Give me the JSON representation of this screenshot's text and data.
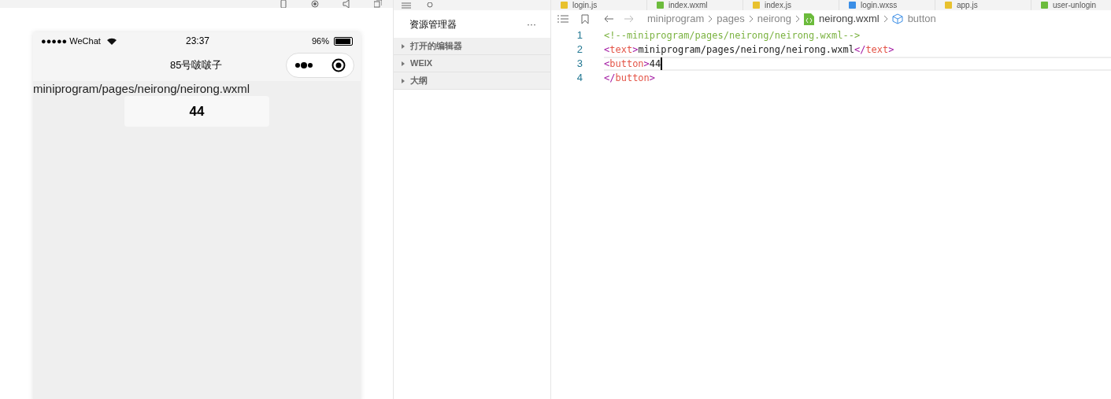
{
  "editor_tabs": [
    {
      "label": "login.js",
      "kind": "js",
      "selected": false
    },
    {
      "label": "index.wxml",
      "kind": "wxml",
      "selected": false
    },
    {
      "label": "index.js",
      "kind": "js",
      "selected": false
    },
    {
      "label": "login.wxss",
      "kind": "wxss",
      "selected": false
    },
    {
      "label": "app.js",
      "kind": "js",
      "selected": false
    },
    {
      "label": "user-unlogin",
      "kind": "wxml",
      "selected": false
    }
  ],
  "phone": {
    "status_bar": {
      "carrier": "●●●●● WeChat",
      "time": "23:37",
      "battery_reading": "96%",
      "battery": {
        "level": 0.96
      }
    },
    "nav_title": "85号啵啵子",
    "page_text": "miniprogram/pages/neirong/neirong.wxml",
    "page_button": "44"
  },
  "explorer": {
    "title": "资源管理器",
    "more": "···",
    "sections": [
      {
        "label": "打开的编辑器",
        "expanded": false
      },
      {
        "label": "WEIX",
        "expanded": false
      },
      {
        "label": "大纲",
        "expanded": false
      }
    ]
  },
  "breadcrumb": [
    {
      "label": "miniprogram",
      "kind": "folder"
    },
    {
      "label": "pages",
      "kind": "folder"
    },
    {
      "label": "neirong",
      "kind": "folder"
    },
    {
      "label": "neirong.wxml",
      "kind": "file"
    },
    {
      "label": "button",
      "kind": "symbol"
    }
  ],
  "code_lines": [
    {
      "number": "1",
      "current": false,
      "tokens": [
        {
          "kind": "comment",
          "text": "<!--miniprogram/pages/neirong/neirong.wxml-->"
        }
      ]
    },
    {
      "number": "2",
      "current": false,
      "tokens": [
        {
          "kind": "bracket",
          "text": "<"
        },
        {
          "kind": "tag",
          "text": "text"
        },
        {
          "kind": "bracket",
          "text": ">"
        },
        {
          "kind": "plain",
          "text": "miniprogram/pages/neirong/neirong.wxml"
        },
        {
          "kind": "bracket",
          "text": "</"
        },
        {
          "kind": "tag",
          "text": "text"
        },
        {
          "kind": "bracket",
          "text": ">"
        }
      ]
    },
    {
      "number": "3",
      "current": true,
      "tokens": [
        {
          "kind": "bracket",
          "text": "<"
        },
        {
          "kind": "tag",
          "text": "button"
        },
        {
          "kind": "bracket",
          "text": ">"
        },
        {
          "kind": "plain",
          "text": "44"
        }
      ]
    },
    {
      "number": "4",
      "current": false,
      "tokens": [
        {
          "kind": "bracket",
          "text": "</"
        },
        {
          "kind": "tag",
          "text": "button"
        },
        {
          "kind": "bracket",
          "text": ">"
        }
      ]
    }
  ]
}
